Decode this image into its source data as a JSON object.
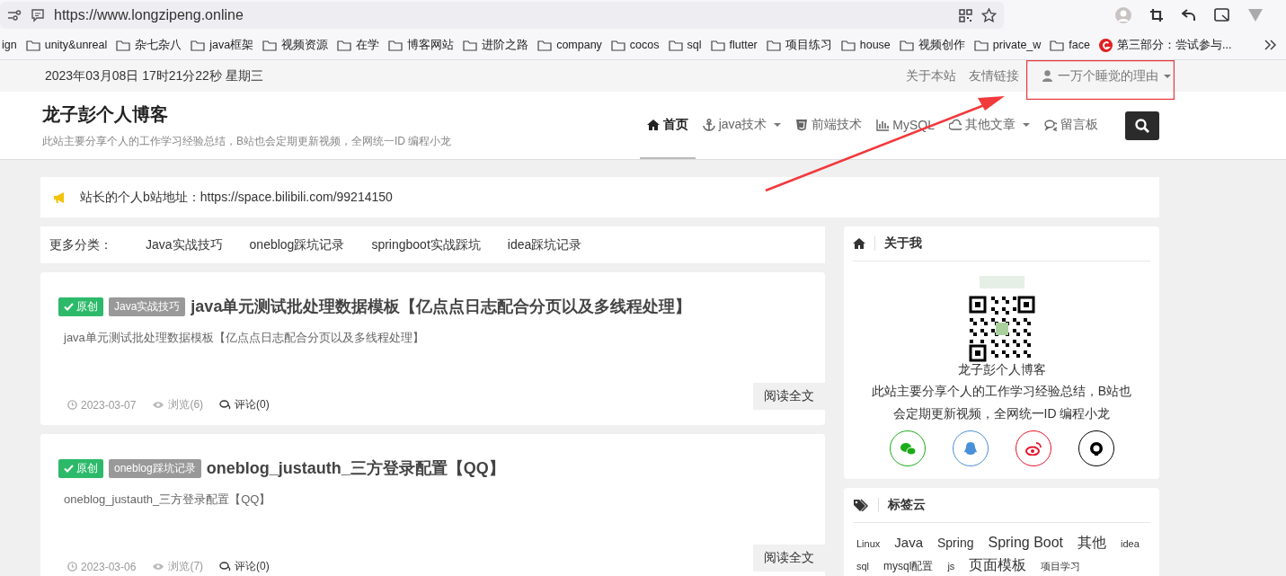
{
  "browser": {
    "url": "https://www.longzipeng.online"
  },
  "bookmarks": [
    {
      "label": "ign",
      "kind": "text"
    },
    {
      "label": "unity&unreal",
      "kind": "folder"
    },
    {
      "label": "杂七杂八",
      "kind": "folder"
    },
    {
      "label": "java框架",
      "kind": "folder"
    },
    {
      "label": "视频资源",
      "kind": "folder"
    },
    {
      "label": "在学",
      "kind": "folder"
    },
    {
      "label": "博客网站",
      "kind": "folder"
    },
    {
      "label": "进阶之路",
      "kind": "folder"
    },
    {
      "label": "company",
      "kind": "folder"
    },
    {
      "label": "cocos",
      "kind": "folder"
    },
    {
      "label": "sql",
      "kind": "folder"
    },
    {
      "label": "flutter",
      "kind": "folder"
    },
    {
      "label": "项目练习",
      "kind": "folder"
    },
    {
      "label": "house",
      "kind": "folder"
    },
    {
      "label": "视频创作",
      "kind": "folder"
    },
    {
      "label": "private_w",
      "kind": "folder"
    },
    {
      "label": "face",
      "kind": "folder"
    },
    {
      "label": "第三部分：尝试参与...",
      "kind": "site"
    }
  ],
  "topbar": {
    "datetime": "2023年03月08日 17时21分22秒 星期三",
    "links": [
      "关于本站",
      "友情链接"
    ],
    "user": "一万个睡觉的理由"
  },
  "header": {
    "title": "龙子彭个人博客",
    "subtitle": "此站主要分享个人的工作学习经验总结，B站也会定期更新视频，全网统一ID 编程小龙",
    "nav": [
      {
        "label": "首页",
        "kind": "home",
        "dropdown": false,
        "selected": true
      },
      {
        "label": "java技术",
        "kind": "anchor",
        "dropdown": true,
        "selected": false
      },
      {
        "label": "前端技术",
        "kind": "css",
        "dropdown": false,
        "selected": false
      },
      {
        "label": "MySQL",
        "kind": "chart",
        "dropdown": false,
        "selected": false
      },
      {
        "label": "其他文章",
        "kind": "cloud",
        "dropdown": true,
        "selected": false
      },
      {
        "label": "留言板",
        "kind": "comments",
        "dropdown": false,
        "selected": false
      }
    ]
  },
  "notice": "站长的个人b站地址：https://space.bilibili.com/99214150",
  "categories": {
    "label": "更多分类：",
    "items": [
      "Java实战技巧",
      "oneblog踩坑记录",
      "springboot实战踩坑",
      "idea踩坑记录"
    ]
  },
  "posts": [
    {
      "badge": "原创",
      "category": "Java实战技巧",
      "title": "java单元测试批处理数据模板【亿点点日志配合分页以及多线程处理】",
      "summary": "java单元测试批处理数据模板【亿点点日志配合分页以及多线程处理】",
      "date": "2023-03-07",
      "views": "浏览(6)",
      "comments": "评论(0)",
      "button": "阅读全文"
    },
    {
      "badge": "原创",
      "category": "oneblog踩坑记录",
      "title": "oneblog_justauth_三方登录配置【QQ】",
      "summary": "oneblog_justauth_三方登录配置【QQ】",
      "date": "2023-03-06",
      "views": "浏览(7)",
      "comments": "评论(0)",
      "button": "阅读全文"
    }
  ],
  "about": {
    "title": "关于我",
    "name": "龙子彭个人博客",
    "description": "此站主要分享个人的工作学习经验总结，B站也会定期更新视频，全网统一ID 编程小龙",
    "social": [
      {
        "kind": "wechat",
        "color": "#1aad19"
      },
      {
        "kind": "qq",
        "color": "#4a90d9"
      },
      {
        "kind": "weibo",
        "color": "#e6162d"
      },
      {
        "kind": "github",
        "color": "#000000"
      }
    ]
  },
  "tag_cloud": {
    "title": "标签云",
    "tags": [
      "Linux",
      "Java",
      "Spring",
      "Spring Boot",
      "其他",
      "idea",
      "sql",
      "mysql配置",
      "js",
      "页面模板",
      "项目学习"
    ]
  }
}
